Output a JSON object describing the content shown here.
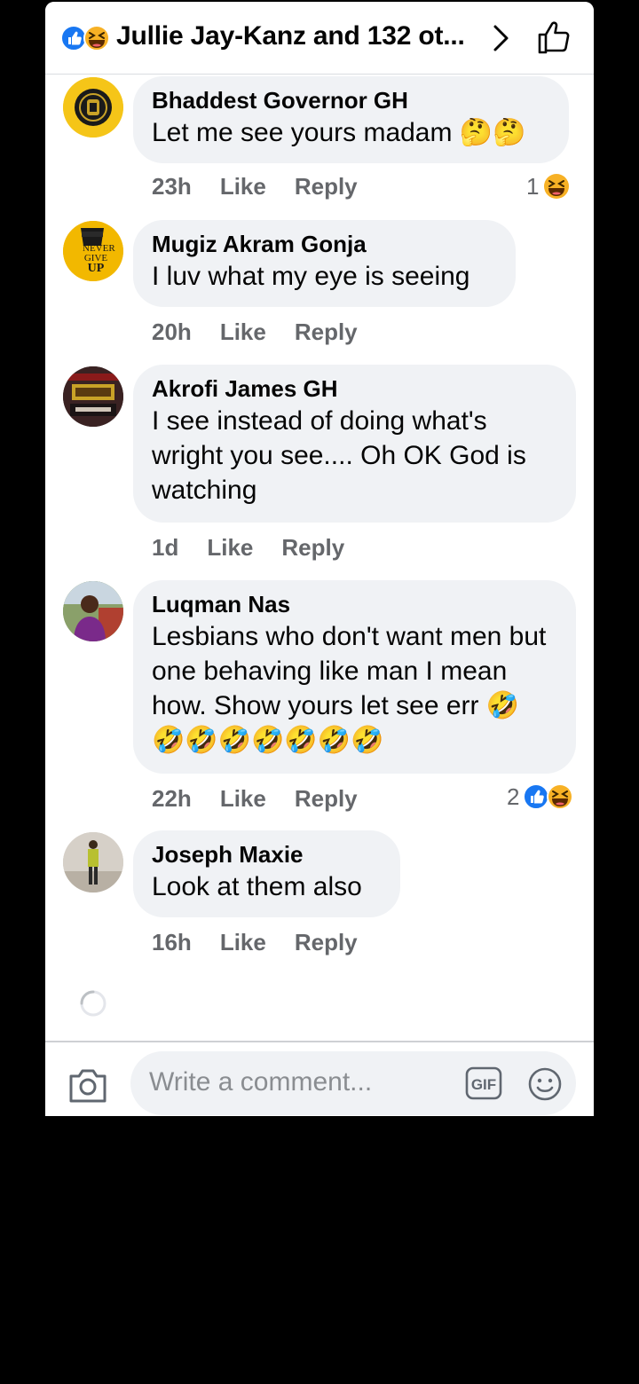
{
  "header": {
    "title": "Jullie Jay-Kanz and 132 ot...",
    "reactions": [
      "like-icon",
      "haha-icon"
    ]
  },
  "comments": [
    {
      "name": "Bhaddest Governor GH",
      "text": "Let me see yours madam 🤔🤔",
      "time": "23h",
      "like_label": "Like",
      "reply_label": "Reply",
      "reaction_count": "1",
      "reactions": [
        "haha-icon"
      ]
    },
    {
      "name": "Mugiz Akram Gonja",
      "text": "I luv what my eye is seeing",
      "time": "20h",
      "like_label": "Like",
      "reply_label": "Reply",
      "avatar_text": [
        "NEVER",
        "GIVE",
        "UP"
      ]
    },
    {
      "name": "Akrofi James GH",
      "text": "I see instead of doing what's wright you see.... Oh OK God is watching",
      "time": "1d",
      "like_label": "Like",
      "reply_label": "Reply"
    },
    {
      "name": "Luqman Nas",
      "text": "Lesbians who don't want men but one behaving like man I mean how. Show yours let see err 🤣🤣🤣🤣🤣🤣🤣🤣",
      "time": "22h",
      "like_label": "Like",
      "reply_label": "Reply",
      "reaction_count": "2",
      "reactions": [
        "like-icon",
        "haha-icon"
      ]
    },
    {
      "name": "Joseph Maxie",
      "text": "Look at them also",
      "time": "16h",
      "like_label": "Like",
      "reply_label": "Reply"
    }
  ],
  "composer": {
    "placeholder": "Write a comment...",
    "gif_label": "GIF"
  },
  "colors": {
    "like_blue": "#1877f2",
    "haha_yellow": "#f7b125",
    "meta_gray": "#65676b",
    "bubble_bg": "#f0f2f5"
  }
}
